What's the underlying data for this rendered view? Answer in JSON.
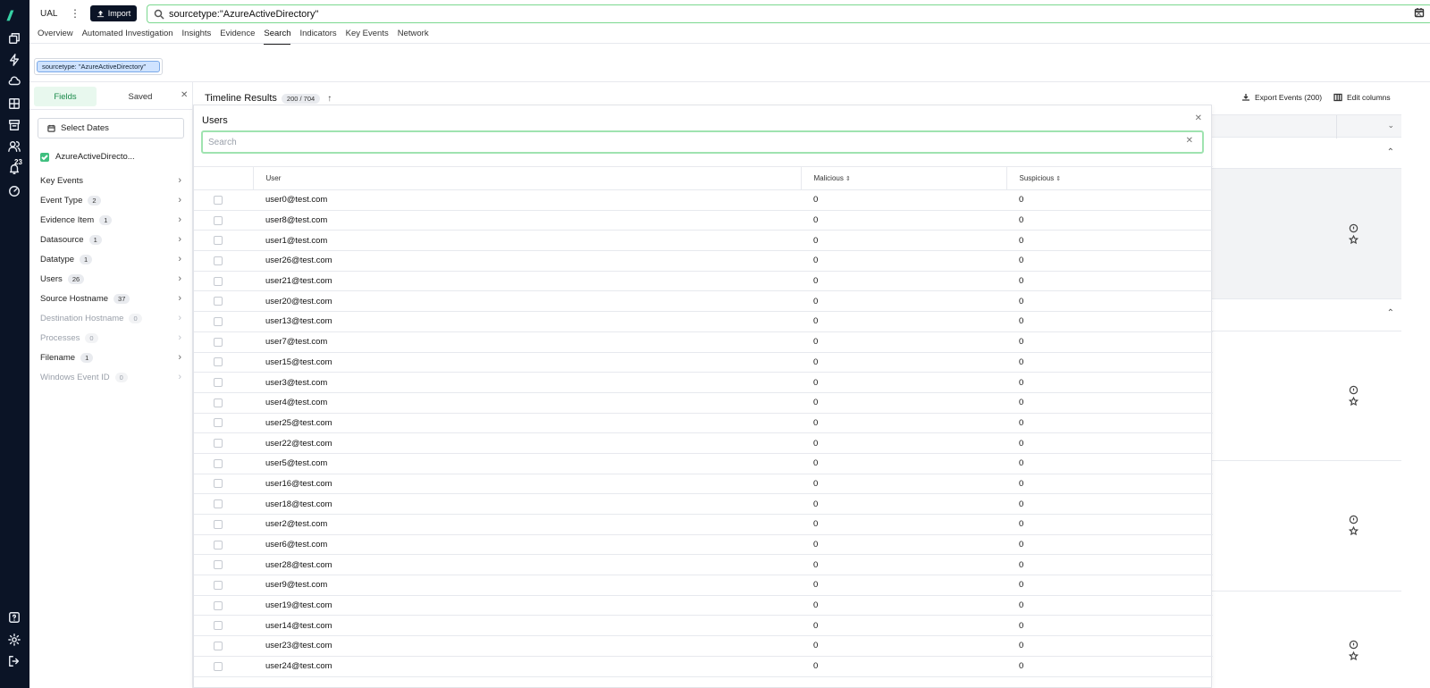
{
  "app": {
    "title": "UAL",
    "more_label": "⋮",
    "import_label": "Import"
  },
  "search": {
    "query": "sourcetype:\"AzureActiveDirectory\"",
    "clear_label": "✕"
  },
  "nav": {
    "tabs": [
      {
        "label": "Overview"
      },
      {
        "label": "Automated Investigation"
      },
      {
        "label": "Insights"
      },
      {
        "label": "Evidence"
      },
      {
        "label": "Search",
        "active": true
      },
      {
        "label": "Indicators"
      },
      {
        "label": "Key Events"
      },
      {
        "label": "Network"
      }
    ]
  },
  "rail": {
    "logo": "//",
    "notification_count": "23",
    "icons": [
      "layers-icon",
      "bolt-icon",
      "cloud-icon",
      "grid-icon",
      "archive-icon",
      "users-icon",
      "bell-icon",
      "gauge-icon",
      "help-icon",
      "gear-icon",
      "logout-icon"
    ]
  },
  "query_chip": {
    "label": "sourcetype: \"AzureActiveDirectory\""
  },
  "sidebar": {
    "fields_tab": "Fields",
    "saved_tab": "Saved",
    "close_label": "✕",
    "select_dates": "Select Dates",
    "source_label": "AzureActiveDirecto...",
    "fields": [
      {
        "label": "Key Events",
        "count": "",
        "dim": false
      },
      {
        "label": "Event Type",
        "count": "2",
        "dim": false
      },
      {
        "label": "Evidence Item",
        "count": "1",
        "dim": false
      },
      {
        "label": "Datasource",
        "count": "1",
        "dim": false
      },
      {
        "label": "Datatype",
        "count": "1",
        "dim": false
      },
      {
        "label": "Users",
        "count": "26",
        "dim": false
      },
      {
        "label": "Source Hostname",
        "count": "37",
        "dim": false
      },
      {
        "label": "Destination Hostname",
        "count": "0",
        "dim": true
      },
      {
        "label": "Processes",
        "count": "0",
        "dim": true
      },
      {
        "label": "Filename",
        "count": "1",
        "dim": false
      },
      {
        "label": "Windows Event ID",
        "count": "0",
        "dim": true
      }
    ]
  },
  "timeline": {
    "title": "Timeline Results",
    "count": "200 / 704",
    "sort_arrow": "↑",
    "export_label": "Export Events (200)",
    "edit_columns_label": "Edit columns"
  },
  "users_popup": {
    "title": "Users",
    "close_label": "✕",
    "search_placeholder": "Search",
    "clear_label": "✕",
    "columns": {
      "user": "User",
      "malicious": "Malicious",
      "suspicious": "Suspicious"
    },
    "rows": [
      {
        "user": "user0@test.com",
        "malicious": "0",
        "suspicious": "0"
      },
      {
        "user": "user8@test.com",
        "malicious": "0",
        "suspicious": "0"
      },
      {
        "user": "user1@test.com",
        "malicious": "0",
        "suspicious": "0"
      },
      {
        "user": "user26@test.com",
        "malicious": "0",
        "suspicious": "0"
      },
      {
        "user": "user21@test.com",
        "malicious": "0",
        "suspicious": "0"
      },
      {
        "user": "user20@test.com",
        "malicious": "0",
        "suspicious": "0"
      },
      {
        "user": "user13@test.com",
        "malicious": "0",
        "suspicious": "0"
      },
      {
        "user": "user7@test.com",
        "malicious": "0",
        "suspicious": "0"
      },
      {
        "user": "user15@test.com",
        "malicious": "0",
        "suspicious": "0"
      },
      {
        "user": "user3@test.com",
        "malicious": "0",
        "suspicious": "0"
      },
      {
        "user": "user4@test.com",
        "malicious": "0",
        "suspicious": "0"
      },
      {
        "user": "user25@test.com",
        "malicious": "0",
        "suspicious": "0"
      },
      {
        "user": "user22@test.com",
        "malicious": "0",
        "suspicious": "0"
      },
      {
        "user": "user5@test.com",
        "malicious": "0",
        "suspicious": "0"
      },
      {
        "user": "user16@test.com",
        "malicious": "0",
        "suspicious": "0"
      },
      {
        "user": "user18@test.com",
        "malicious": "0",
        "suspicious": "0"
      },
      {
        "user": "user2@test.com",
        "malicious": "0",
        "suspicious": "0"
      },
      {
        "user": "user6@test.com",
        "malicious": "0",
        "suspicious": "0"
      },
      {
        "user": "user28@test.com",
        "malicious": "0",
        "suspicious": "0"
      },
      {
        "user": "user9@test.com",
        "malicious": "0",
        "suspicious": "0"
      },
      {
        "user": "user19@test.com",
        "malicious": "0",
        "suspicious": "0"
      },
      {
        "user": "user14@test.com",
        "malicious": "0",
        "suspicious": "0"
      },
      {
        "user": "user23@test.com",
        "malicious": "0",
        "suspicious": "0"
      },
      {
        "user": "user24@test.com",
        "malicious": "0",
        "suspicious": "0"
      }
    ]
  },
  "colors": {
    "rail_bg": "#0b1426",
    "accent_green": "#37d3a6",
    "search_border": "#7bd88f",
    "chip_bg": "#cfe3ff"
  }
}
